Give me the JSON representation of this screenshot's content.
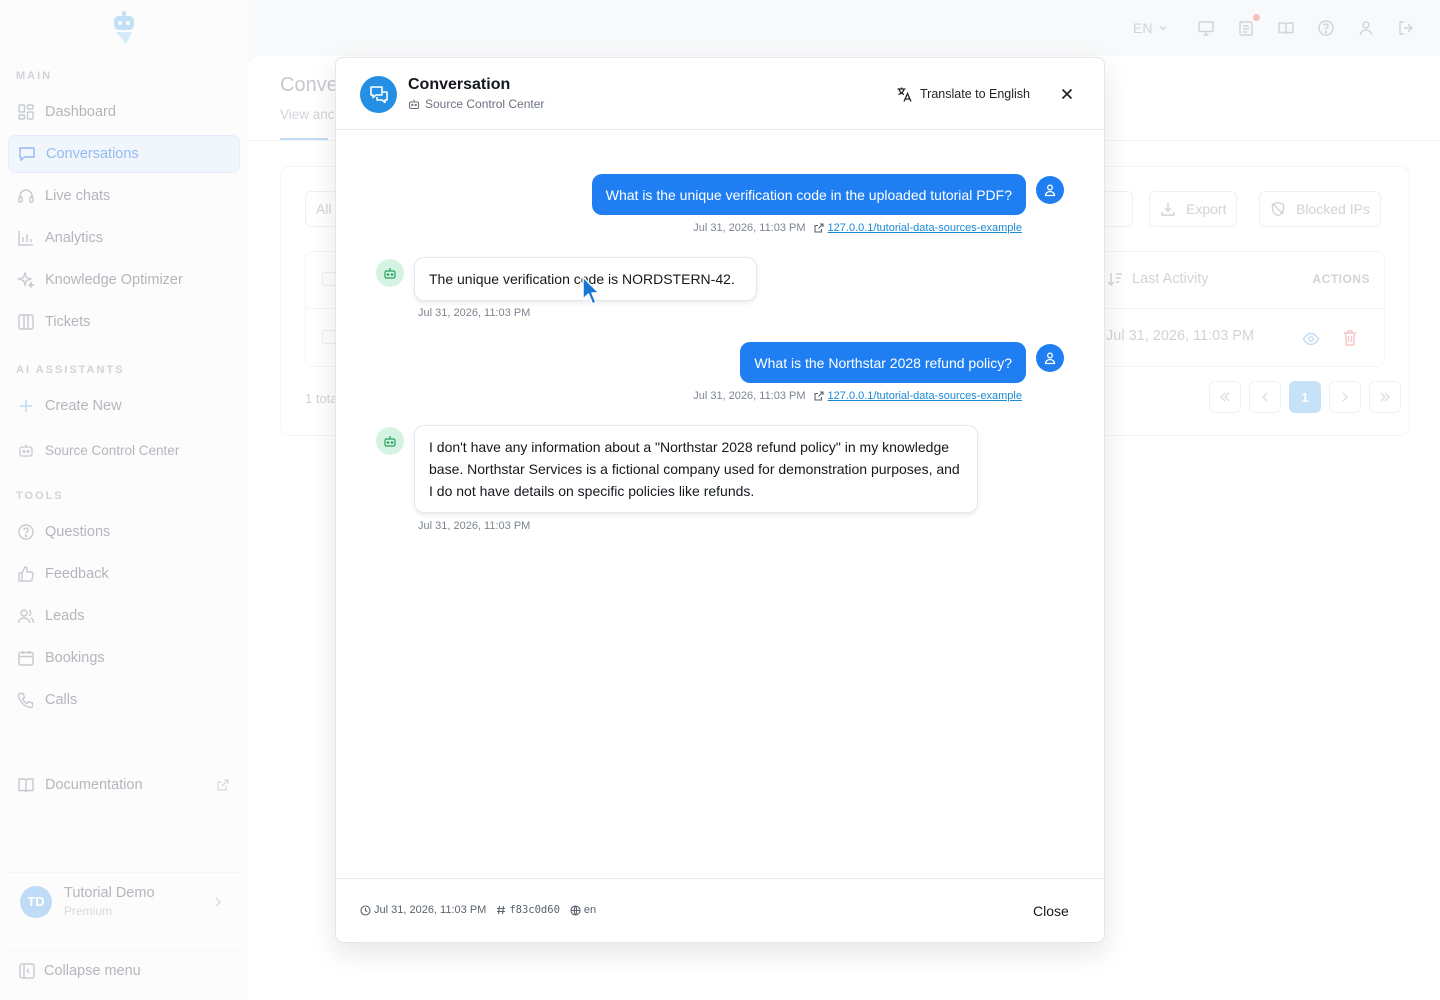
{
  "sidebar": {
    "sections": {
      "main": "MAIN",
      "ai_assistants": "AI ASSISTANTS",
      "tools": "TOOLS"
    },
    "main_items": [
      {
        "label": "Dashboard",
        "icon": "dashboard-icon"
      },
      {
        "label": "Conversations",
        "icon": "chat-icon",
        "active": true
      },
      {
        "label": "Live chats",
        "icon": "headset-icon"
      },
      {
        "label": "Analytics",
        "icon": "bar-chart-icon"
      },
      {
        "label": "Knowledge Optimizer",
        "icon": "sparkles-icon"
      },
      {
        "label": "Tickets",
        "icon": "columns-icon"
      }
    ],
    "create_new": "Create New",
    "assistant": "Source Control Center",
    "tool_items": [
      {
        "label": "Questions",
        "icon": "question-icon"
      },
      {
        "label": "Feedback",
        "icon": "thumbs-up-icon"
      },
      {
        "label": "Leads",
        "icon": "users-icon"
      },
      {
        "label": "Bookings",
        "icon": "calendar-icon"
      },
      {
        "label": "Calls",
        "icon": "phone-icon"
      }
    ],
    "documentation": "Documentation",
    "user": {
      "initials": "TD",
      "name": "Tutorial Demo",
      "plan": "Premium"
    },
    "collapse": "Collapse menu"
  },
  "topbar": {
    "language": "EN"
  },
  "page": {
    "title": "Conve",
    "subtitle": "View anc",
    "filter_all": "All",
    "export": "Export",
    "blocked_ips": "Blocked IPs",
    "col_last_activity": "Last Activity",
    "col_actions": "ACTIONS",
    "row_date": "Jul 31, 2026, 11:03 PM",
    "total": "1 tota",
    "current_page": "1"
  },
  "modal": {
    "title": "Conversation",
    "assistant": "Source Control Center",
    "translate": "Translate to English",
    "messages": [
      {
        "role": "user",
        "text": "What is the unique verification code in the uploaded tutorial PDF?",
        "time": "Jul 31, 2026, 11:03 PM",
        "link": "127.0.0.1/tutorial-data-sources-example"
      },
      {
        "role": "bot",
        "text": "The unique verification code is NORDSTERN-42.",
        "time": "Jul 31, 2026, 11:03 PM"
      },
      {
        "role": "user",
        "text": "What is the Northstar 2028 refund policy?",
        "time": "Jul 31, 2026, 11:03 PM",
        "link": "127.0.0.1/tutorial-data-sources-example"
      },
      {
        "role": "bot",
        "text": "I don't have any information about a \"Northstar 2028 refund policy\" in my knowledge base. Northstar Services is a fictional company used for demonstration purposes, and I do not have details on specific policies like refunds.",
        "time": "Jul 31, 2026, 11:03 PM"
      }
    ],
    "footer": {
      "timestamp": "Jul 31, 2026, 11:03 PM",
      "conversation_id": "f83c0d60",
      "language": "en",
      "close": "Close"
    }
  },
  "colors": {
    "accent": "#1f7ff2",
    "bot_avatar_bg": "#d5f3e2",
    "header_icon_bg": "#2590e3"
  }
}
